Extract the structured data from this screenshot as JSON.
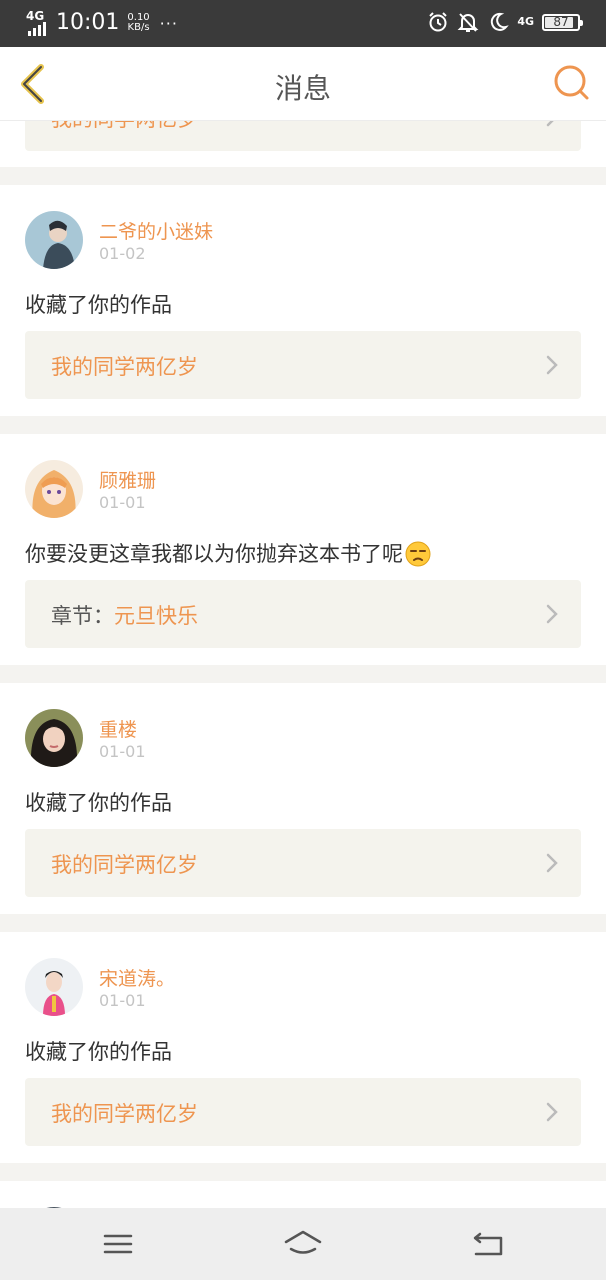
{
  "status_bar": {
    "network": "4G",
    "time": "10:01",
    "speed_value": "0.10",
    "speed_unit": "KB/s",
    "more": "···",
    "network2": "4G",
    "battery": "87"
  },
  "header": {
    "title": "消息",
    "back_icon": "chevron-left-icon",
    "search_icon": "search-icon",
    "accent": "#ee9550"
  },
  "cards": [
    {
      "link": "我的同学两亿岁"
    },
    {
      "name": "二爷的小迷妹",
      "date": "01-02",
      "text": "收藏了你的作品",
      "link": "我的同学两亿岁"
    },
    {
      "name": "顾雅珊",
      "date": "01-01",
      "text": "你要没更这章我都以为你抛弃这本书了呢",
      "emoji": "unamused-face-emoji",
      "link_prefix": "章节：",
      "link": "元旦快乐"
    },
    {
      "name": "重楼",
      "date": "01-01",
      "text": "收藏了你的作品",
      "link": "我的同学两亿岁"
    },
    {
      "name": "宋道涛。",
      "date": "01-01",
      "text": "收藏了你的作品",
      "link": "我的同学两亿岁"
    }
  ],
  "nav": {
    "menu_icon": "menu-icon",
    "home_icon": "home-icon",
    "back_icon": "back-icon"
  }
}
